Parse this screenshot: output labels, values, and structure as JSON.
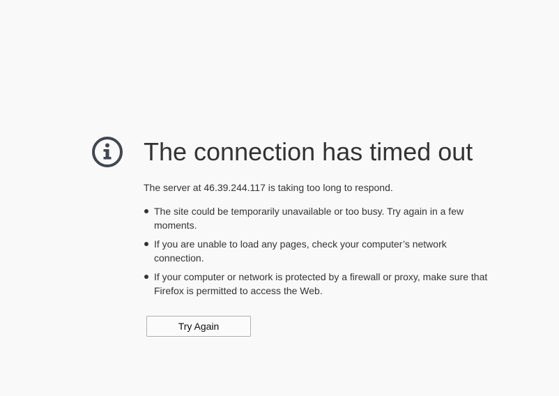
{
  "error_page": {
    "icon": "info-icon",
    "icon_color": "#414750",
    "title": "The connection has timed out",
    "description": "The server at 46.39.244.117 is taking too long to respond.",
    "suggestions": [
      "The site could be temporarily unavailable or too busy. Try again in a few moments.",
      "If you are unable to load any pages, check your computer’s network connection.",
      "If your computer or network is protected by a firewall or proxy, make sure that Firefox is permitted to access the Web."
    ],
    "try_again_label": "Try Again"
  }
}
